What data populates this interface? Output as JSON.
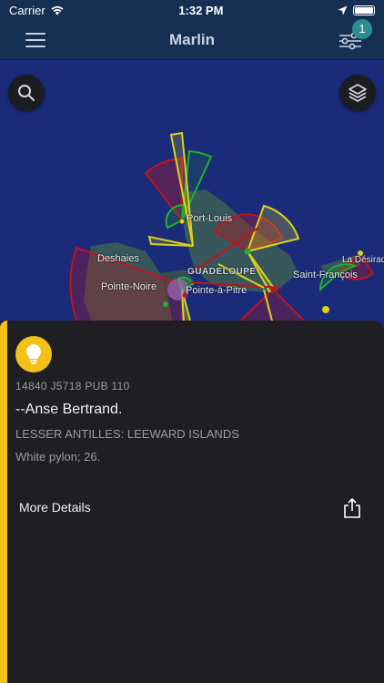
{
  "status_bar": {
    "carrier": "Carrier",
    "time": "1:32 PM"
  },
  "nav": {
    "title": "Marlin",
    "filter_badge": "1"
  },
  "map": {
    "places": [
      {
        "name": "Port-Louis"
      },
      {
        "name": "Deshaies"
      },
      {
        "name": "GUADELOUPE"
      },
      {
        "name": "Pointe-Noire"
      },
      {
        "name": "Pointe-à-Pitre"
      },
      {
        "name": "Saint-François"
      },
      {
        "name": "La Désirad"
      }
    ],
    "colors": {
      "sea": "#1a2b7a",
      "land": "#3b5c57",
      "red_sector": "#c0141c",
      "green_sector": "#23b02a",
      "yellow_sector": "#d9d21c"
    }
  },
  "light": {
    "icon": "lightbulb-icon",
    "code": "14840 J5718 PUB 110",
    "name": "--Anse Bertrand.",
    "region": "LESSER ANTILLES: LEEWARD ISLANDS",
    "remarks": "White pylon; 26.",
    "accent_color": "#f2c219"
  },
  "actions": {
    "more_details": "More Details"
  }
}
